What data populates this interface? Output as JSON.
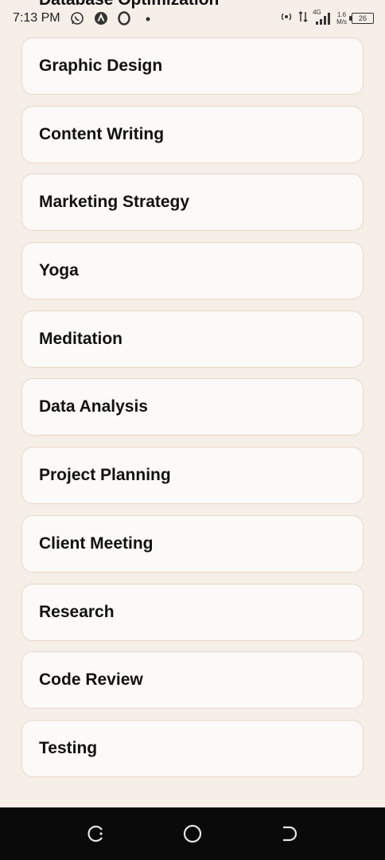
{
  "status_bar": {
    "time": "7:13 PM",
    "network_type": "4G",
    "speed_value": "1.6",
    "speed_unit": "M/s",
    "battery": "26"
  },
  "cutoff_item": {
    "label": "Database Optimization"
  },
  "tasks": [
    {
      "label": "Graphic Design"
    },
    {
      "label": "Content Writing"
    },
    {
      "label": "Marketing Strategy"
    },
    {
      "label": "Yoga"
    },
    {
      "label": "Meditation"
    },
    {
      "label": "Data Analysis"
    },
    {
      "label": "Project Planning"
    },
    {
      "label": "Client Meeting"
    },
    {
      "label": "Research"
    },
    {
      "label": "Code Review"
    },
    {
      "label": "Testing"
    }
  ],
  "colors": {
    "background": "#f6efe8",
    "card": "#fbfaf8",
    "card_border": "#ecd6c4",
    "navbar": "#0a0a0a"
  }
}
